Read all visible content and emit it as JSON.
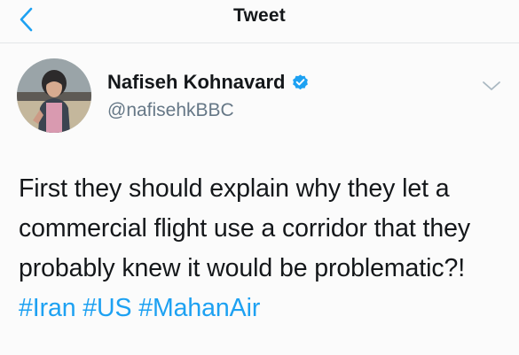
{
  "header": {
    "title": "Tweet",
    "back_icon": "chevron-left-icon"
  },
  "tweet": {
    "author_name": "Nafiseh Kohnavard",
    "author_handle": "@nafisehkBBC",
    "verified": true,
    "text": "First they should explain why they let a commercial flight use a corridor that they probably knew it would be problematic?!",
    "hashtags": [
      "#Iran",
      "#US",
      "#MahanAir"
    ]
  },
  "colors": {
    "accent": "#1da1f2",
    "text": "#14171a",
    "secondary_text": "#657786"
  }
}
